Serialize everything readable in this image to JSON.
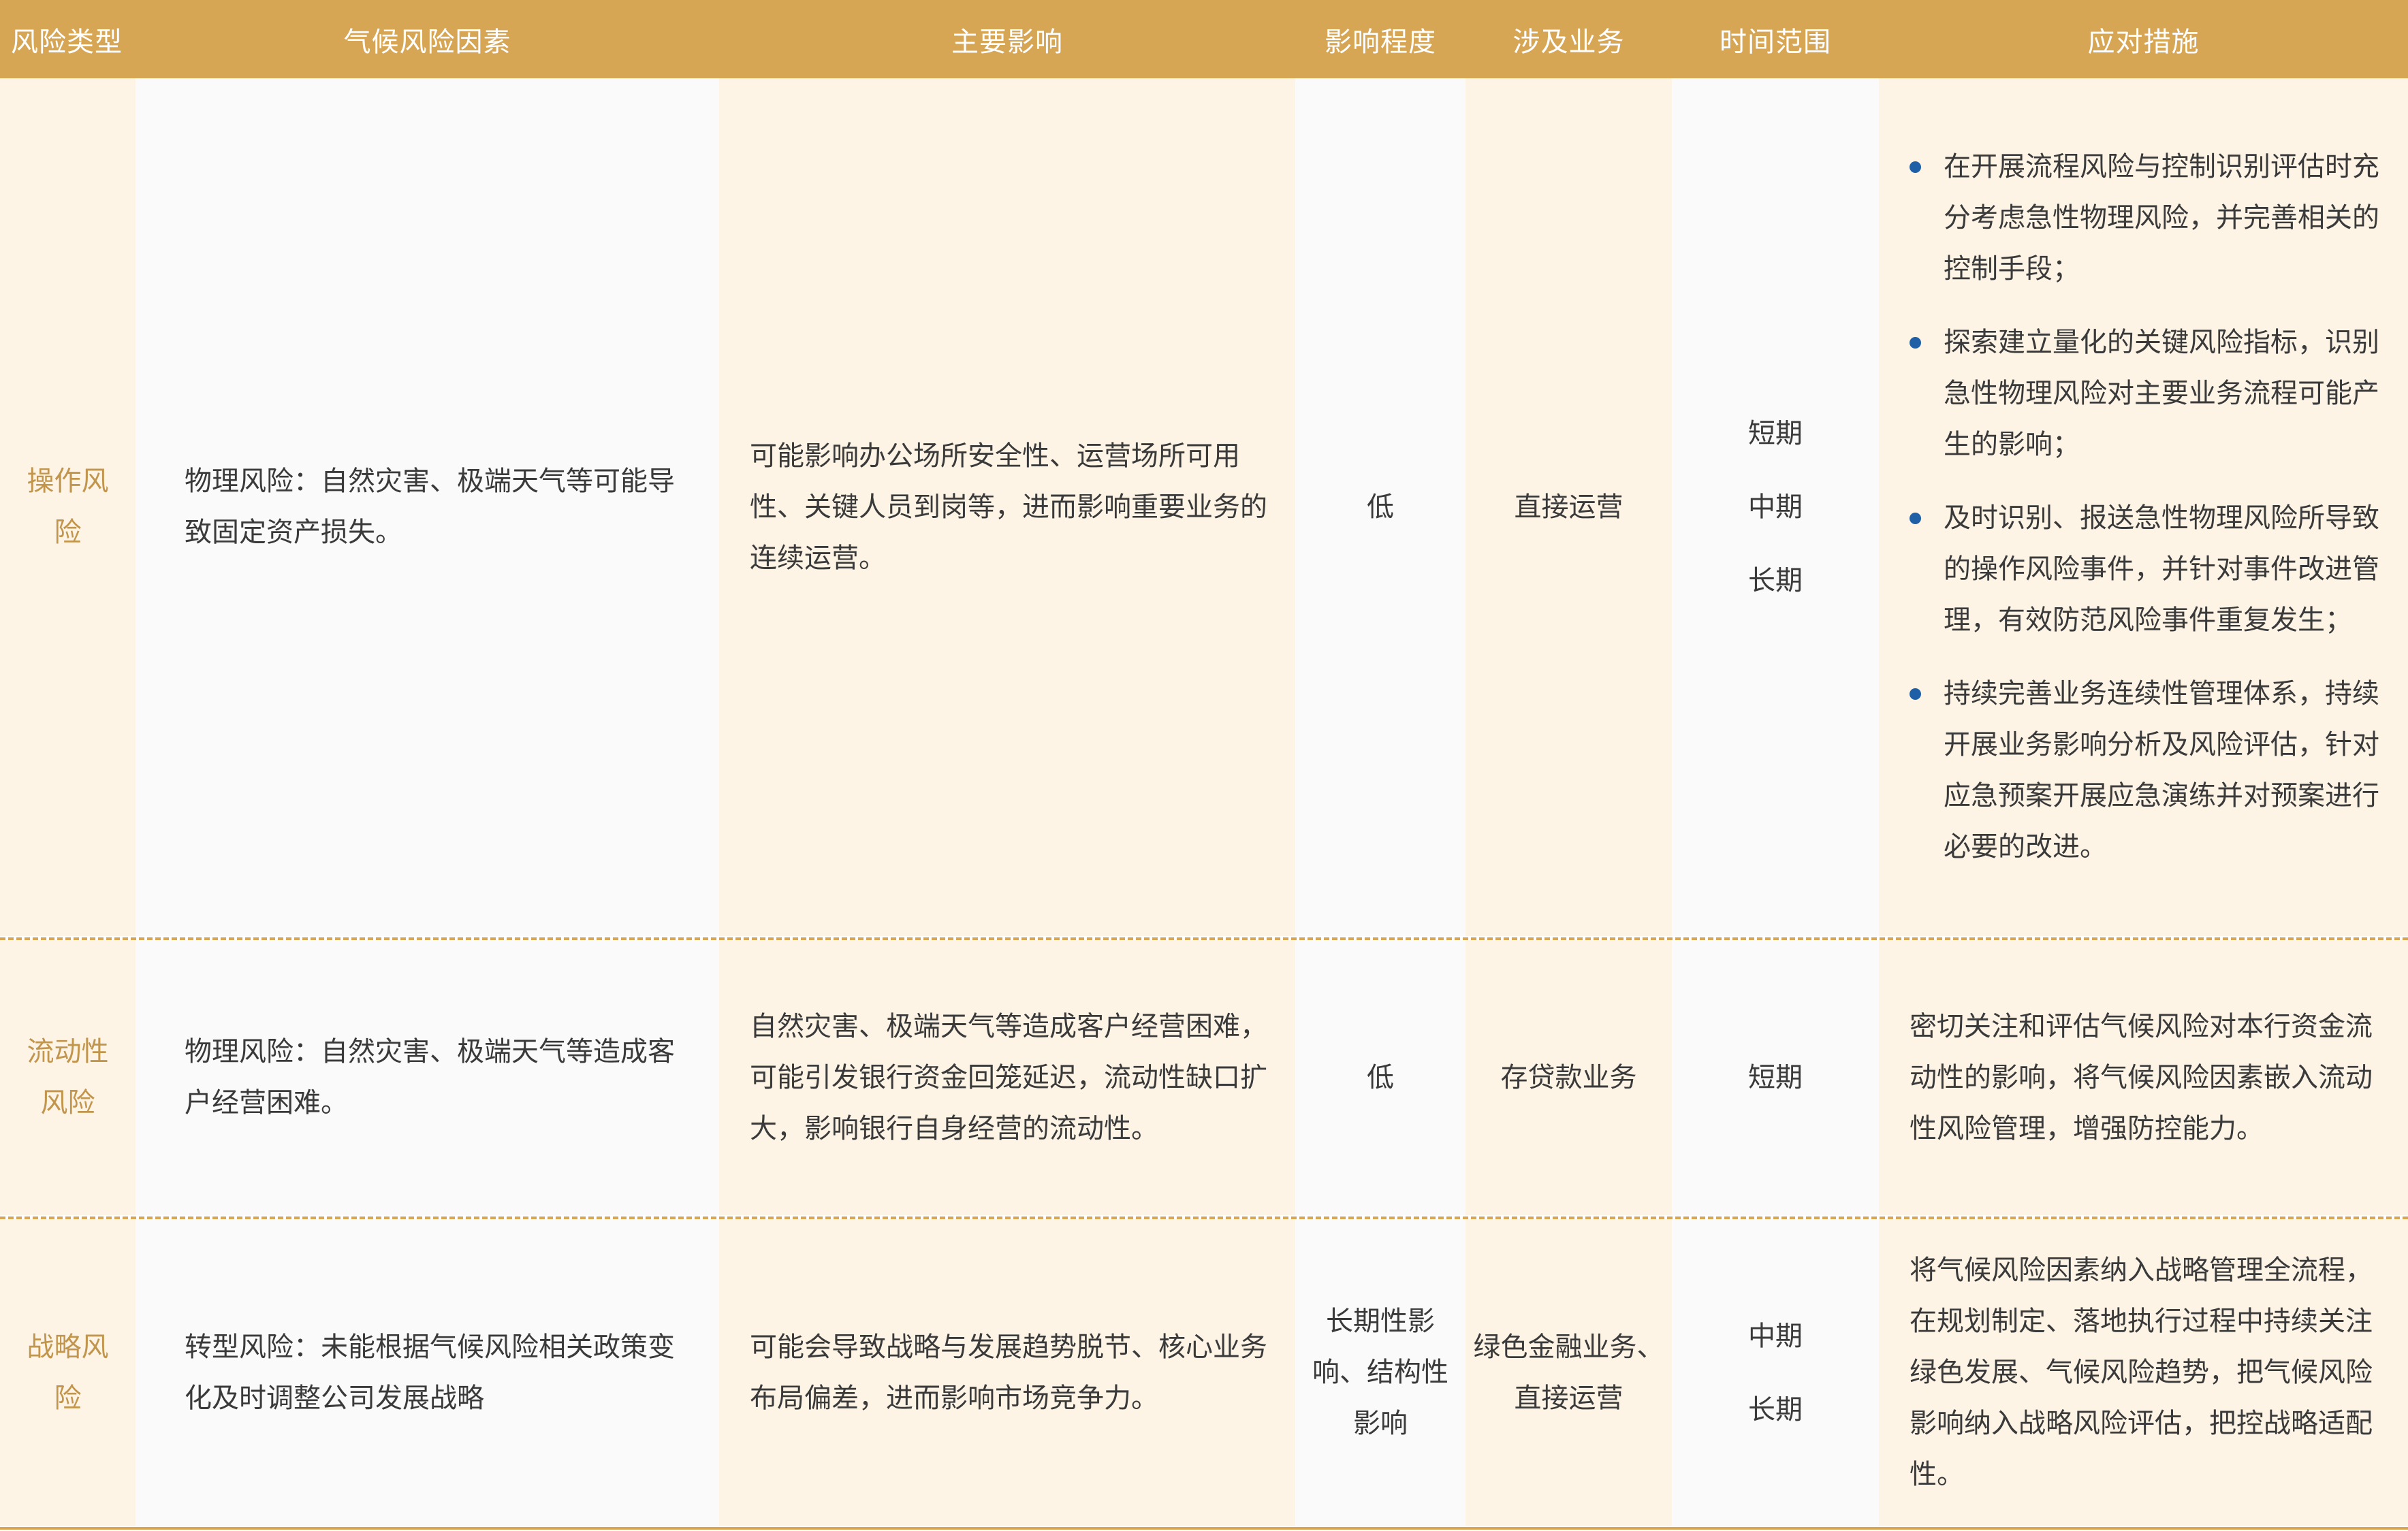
{
  "header": [
    "风险类型",
    "气候风险因素",
    "主要影响",
    "影响程度",
    "涉及业务",
    "时间范围",
    "应对措施"
  ],
  "rows": [
    {
      "type": "操作风险",
      "factor": "物理风险：自然灾害、极端天气等可能导致固定资产损失。",
      "impact": "可能影响办公场所安全性、运营场所可用性、关键人员到岗等，进而影响重要业务的连续运营。",
      "level": "低",
      "business": "直接运营",
      "time": [
        "短期",
        "中期",
        "长期"
      ],
      "measures": [
        "在开展流程风险与控制识别评估时充分考虑急性物理风险，并完善相关的控制手段；",
        "探索建立量化的关键风险指标，识别急性物理风险对主要业务流程可能产生的影响；",
        "及时识别、报送急性物理风险所导致的操作风险事件，并针对事件改进管理，有效防范风险事件重复发生；",
        "持续完善业务连续性管理体系，持续开展业务影响分析及风险评估，针对应急预案开展应急演练并对预案进行必要的改进。"
      ]
    },
    {
      "type": "流动性风险",
      "factor": "物理风险：自然灾害、极端天气等造成客户经营困难。",
      "impact": "自然灾害、极端天气等造成客户经营困难，可能引发银行资金回笼延迟，流动性缺口扩大，影响银行自身经营的流动性。",
      "level": "低",
      "business": "存贷款业务",
      "time": [
        "短期"
      ],
      "measures_text": "密切关注和评估气候风险对本行资金流动性的影响，将气候风险因素嵌入流动性风险管理，增强防控能力。"
    },
    {
      "type": "战略风险",
      "factor": "转型风险：未能根据气候风险相关政策变化及时调整公司发展战略",
      "impact": "可能会导致战略与发展趋势脱节、核心业务布局偏差，进而影响市场竞争力。",
      "level": "长期性影响、结构性影响",
      "business": "绿色金融业务、直接运营",
      "time": [
        "中期",
        "长期"
      ],
      "measures_text": "将气候风险因素纳入战略管理全流程，在规划制定、落地执行过程中持续关注绿色发展、气候风险趋势，把气候风险影响纳入战略风险评估，把控战略适配性。"
    }
  ]
}
